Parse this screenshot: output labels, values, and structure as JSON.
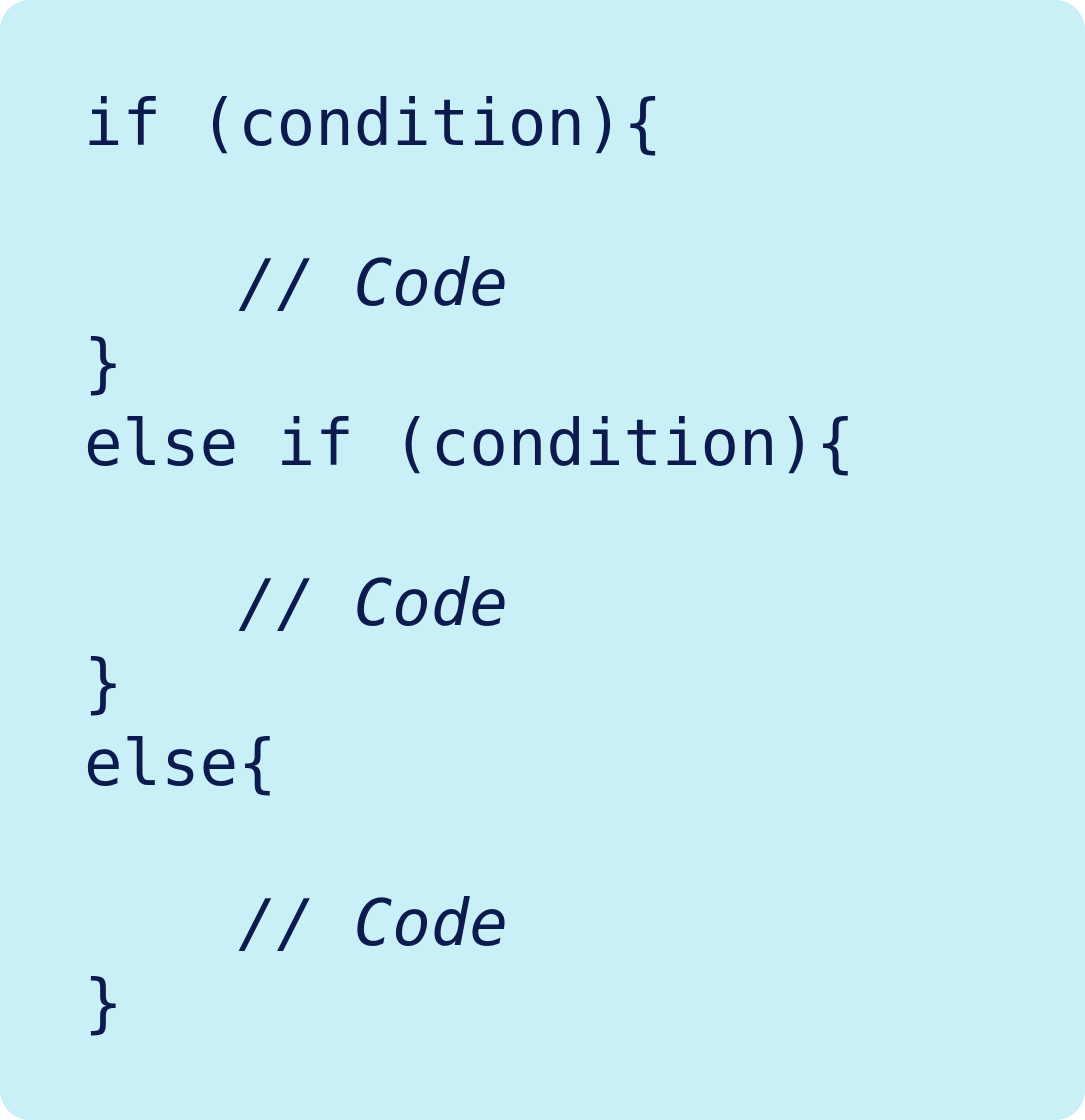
{
  "code": {
    "text_color": "#0d1a4d",
    "background_color": "#c9eff7",
    "lines": [
      "if (condition){",
      "",
      "    // Code",
      "}",
      "else if (condition){",
      "",
      "    // Code",
      "}",
      "else{",
      "",
      "    // Code",
      "}"
    ]
  }
}
